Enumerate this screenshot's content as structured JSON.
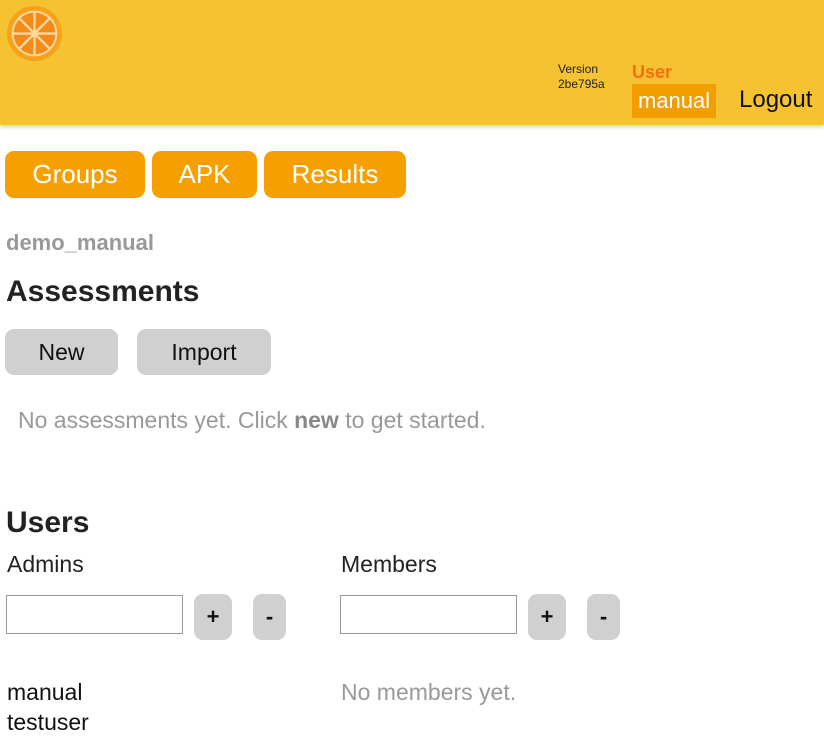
{
  "header": {
    "version_label": "Version",
    "version_hash": "2be795a",
    "user_label": "User",
    "user_name": "manual",
    "logout_label": "Logout"
  },
  "nav": {
    "groups_label": "Groups",
    "apk_label": "APK",
    "results_label": "Results"
  },
  "group": {
    "name": "demo_manual"
  },
  "assessments": {
    "heading": "Assessments",
    "new_label": "New",
    "import_label": "Import",
    "empty_prefix": "No assessments yet. Click ",
    "empty_keyword": "new",
    "empty_suffix": " to get started."
  },
  "users": {
    "heading": "Users",
    "admins_label": "Admins",
    "members_label": "Members",
    "add_label": "+",
    "remove_label": "-",
    "admin_input_value": "",
    "member_input_value": "",
    "admins": [
      "manual",
      "testuser"
    ],
    "no_members_text": "No members yet."
  },
  "colors": {
    "header_bg": "#f5c232",
    "accent_orange": "#f5a000",
    "user_label": "#f36f10",
    "button_grey": "#d0d0d0"
  }
}
